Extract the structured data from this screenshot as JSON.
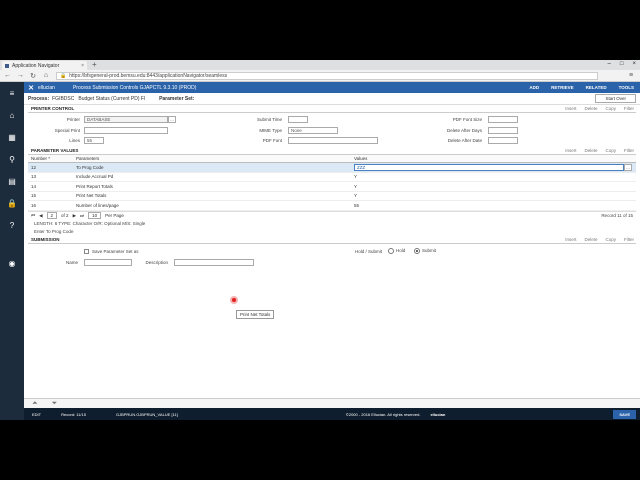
{
  "browser": {
    "tab_title": "Application Navigator",
    "url": "https://bfsgeneral-prod.bemsu.edu:8443/applicationNavigator/seamless"
  },
  "header": {
    "logo": "ellucian",
    "title": "Process Submission Controls GJAPCTL 9.3.10 (PROD)",
    "actions": [
      "ADD",
      "RETRIEVE",
      "RELATED",
      "TOOLS"
    ]
  },
  "key_block": {
    "process_label": "Process:",
    "process_value": "FGIBDSC",
    "process_desc": "Budget Status (Current PD) Fl",
    "param_set_label": "Parameter Set:",
    "start_over": "Start Over"
  },
  "printer_control": {
    "title": "PRINTER CONTROL",
    "tools": [
      "Insert",
      "Delete",
      "Copy",
      "Filter"
    ],
    "printer_label": "Printer",
    "printer_value": "DATABASE",
    "special_print_label": "Special Print",
    "lines_label": "Lines",
    "lines_value": "55",
    "submit_time_label": "Submit Time",
    "mime_type_label": "MIME Type",
    "mime_type_value": "None",
    "pdf_font_label": "PDF Font",
    "pdf_font_size_label": "PDF Font Size",
    "delete_after_days_label": "Delete After Days",
    "delete_after_date_label": "Delete After Date"
  },
  "parameter_values": {
    "title": "PARAMETER VALUES",
    "tools": [
      "Insert",
      "Delete",
      "Copy",
      "Filter"
    ],
    "col_number": "Number *",
    "col_parameters": "Parameters",
    "col_values": "Values",
    "rows": [
      {
        "number": "12",
        "parameter": "To Prog Code",
        "value": "ZZZ"
      },
      {
        "number": "13",
        "parameter": "Include Accrual Pd",
        "value": "Y"
      },
      {
        "number": "14",
        "parameter": "Print Report Totals",
        "value": "Y"
      },
      {
        "number": "15",
        "parameter": "Print Net Totals",
        "value": "Y"
      },
      {
        "number": "16",
        "parameter": "Number of lines/page",
        "value": "55"
      }
    ],
    "page_current": "2",
    "page_of": "of 2",
    "per_page_value": "10",
    "per_page_label": "Per Page",
    "record": "Record 11 of 15",
    "info_line1": "LENGTH: 6 TYPE: Character O/R: Optional M/S: Single",
    "info_line2": "Enter To Prog Code",
    "tooltip": "Print Net Totals"
  },
  "submission": {
    "title": "SUBMISSION",
    "tools": [
      "Insert",
      "Delete",
      "Copy",
      "Filter"
    ],
    "save_param_label": "Save Parameter Set as",
    "name_label": "Name",
    "description_label": "Description",
    "hold_submit_label": "Hold / Submit",
    "hold_label": "Hold",
    "submit_label": "Submit"
  },
  "footer": {
    "edit": "EDIT",
    "record": "Record: 11/15",
    "field": "GJBPRUN.GJBPRUN_VALUE [11]",
    "copyright": "©2000 - 2016 Ellucian. All rights reserved.",
    "brand": "ellucian",
    "save": "SAVE"
  }
}
